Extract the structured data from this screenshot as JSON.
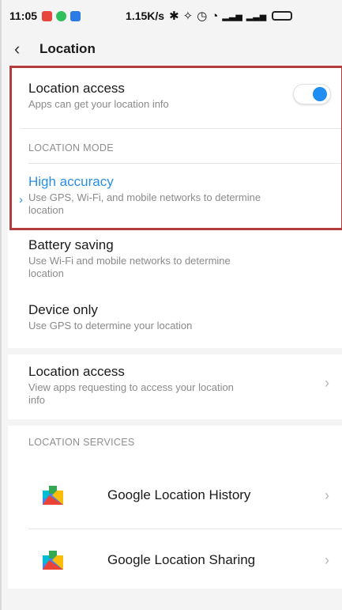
{
  "status_bar": {
    "time": "11:05",
    "net_speed": "1.15K/s",
    "icons": [
      "notification-icon",
      "chat-icon",
      "app-icon",
      "bluetooth-icon",
      "vibrate-off-icon",
      "alarm-icon",
      "wifi-icon",
      "signal-icon",
      "signal-icon",
      "battery-icon"
    ]
  },
  "header": {
    "title": "Location",
    "back_icon": "back-chevron-icon"
  },
  "location_access_toggle": {
    "title": "Location access",
    "subtitle": "Apps can get your location info",
    "enabled": true
  },
  "location_mode": {
    "label": "LOCATION MODE",
    "options": [
      {
        "title": "High accuracy",
        "subtitle_line1": "Use GPS, Wi-Fi, and mobile networks to determine",
        "subtitle_line2": "location",
        "selected": true
      },
      {
        "title": "Battery saving",
        "subtitle_line1": "Use Wi-Fi and mobile networks to determine",
        "subtitle_line2": "location",
        "selected": false
      },
      {
        "title": "Device only",
        "subtitle_line1": "Use GPS to determine your location",
        "subtitle_line2": "",
        "selected": false
      }
    ]
  },
  "location_access_apps": {
    "title": "Location access",
    "subtitle_line1": "View apps requesting to access your location",
    "subtitle_line2": "info"
  },
  "location_services": {
    "label": "LOCATION SERVICES",
    "items": [
      {
        "title": "Google Location History",
        "icon": "google-play-services-icon"
      },
      {
        "title": "Google Location Sharing",
        "icon": "google-play-services-icon"
      }
    ]
  },
  "colors": {
    "accent": "#2a8ee6",
    "toggle_on": "#1f8ef0",
    "highlight_border": "#b33d3d"
  }
}
